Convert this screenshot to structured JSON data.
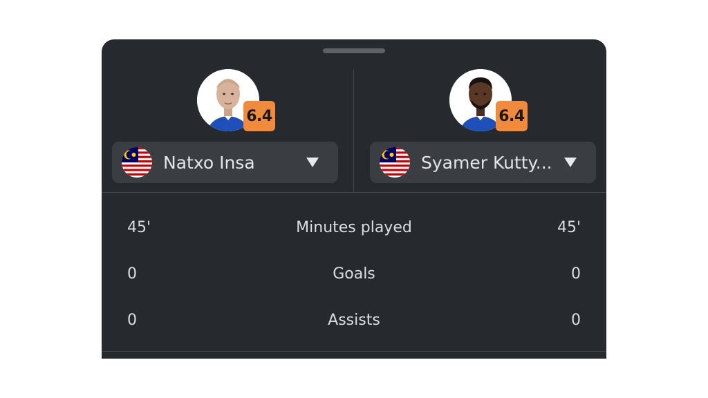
{
  "players": {
    "left": {
      "name": "Natxo Insa",
      "rating": "6.4",
      "flag_icon": "malaysia-flag-icon"
    },
    "right": {
      "name": "Syamer Kutty...",
      "rating": "6.4",
      "flag_icon": "malaysia-flag-icon"
    }
  },
  "stats": [
    {
      "label": "Minutes played",
      "left": "45'",
      "right": "45'"
    },
    {
      "label": "Goals",
      "left": "0",
      "right": "0"
    },
    {
      "label": "Assists",
      "left": "0",
      "right": "0"
    }
  ],
  "colors": {
    "sheet_background": "#26292d",
    "selector_background": "#3a3d42",
    "rating_badge": "#f08a3c",
    "divider": "#45484d"
  }
}
